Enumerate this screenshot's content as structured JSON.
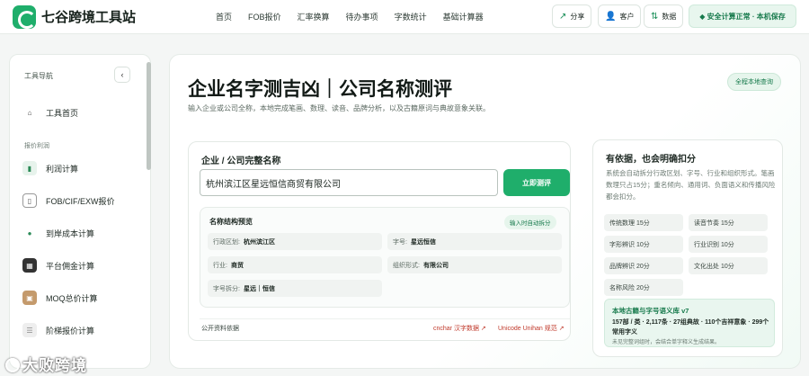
{
  "header": {
    "app_name": "七谷跨境工具站",
    "nav": [
      "首页",
      "FOB报价",
      "汇率换算",
      "待办事项",
      "字数统计",
      "基础计算器"
    ],
    "buttons": {
      "share": "分享",
      "customer": "客户",
      "data": "数据"
    },
    "status": "◆ 安全计算正常 · 本机保存"
  },
  "sidebar": {
    "heading": "工具导航",
    "home": "工具首页",
    "section": "报价利润",
    "items": [
      "利润计算",
      "FOB/CIF/EXW报价",
      "到岸成本计算",
      "平台佣金计算",
      "MOQ总价计算",
      "阶梯报价计算"
    ]
  },
  "main": {
    "title": "企业名字测吉凶｜公司名称测评",
    "subtitle": "输入企业或公司全称，本地完成笔画、数理、读音、品牌分析，以及古籍原词与典故意象关联。",
    "badge": "全程本地查询",
    "input_label": "企业 / 公司完整名称",
    "input_value": "杭州滨江区星远恒信商贸有限公司",
    "submit": "立即测评",
    "preview": {
      "title": "名称结构预览",
      "badge": "输入时自动拆分",
      "region_label": "行政区划:",
      "region_value": "杭州滨江区",
      "brand_label": "字号:",
      "brand_value": "星远恒信",
      "industry_label": "行业:",
      "industry_value": "商贸",
      "form_label": "组织形式:",
      "form_value": "有限公司",
      "split_label": "字号拆分:",
      "split_value": "星远｜恒信"
    },
    "footer": {
      "source": "公开资料依据",
      "link1": "cnchar 汉字数据 ↗",
      "link2": "Unicode Unihan 规范 ↗"
    }
  },
  "right": {
    "title": "有依据，也会明确扣分",
    "desc": "系统会自动拆分行政区划、字号、行业和组织形式。笔画数理只占15分；重名倾向、通用词、负面语义和传播风险都会扣分。",
    "chips": [
      "传统数理 15分",
      "读音节奏 15分",
      "字形辨识 10分",
      "行业识别 10分",
      "品牌辨识 20分",
      "文化出处 10分",
      "名称风险 20分"
    ],
    "box_title": "本地古籍与字号语义库 v7",
    "box_line1": "157部 / 类 · 2,117条 · 27组典故 · 110个吉祥意象 · 299个常用字义",
    "box_line2": "未见完整词组时，会结合单字释义生成结果。"
  },
  "watermark": "大败跨境"
}
